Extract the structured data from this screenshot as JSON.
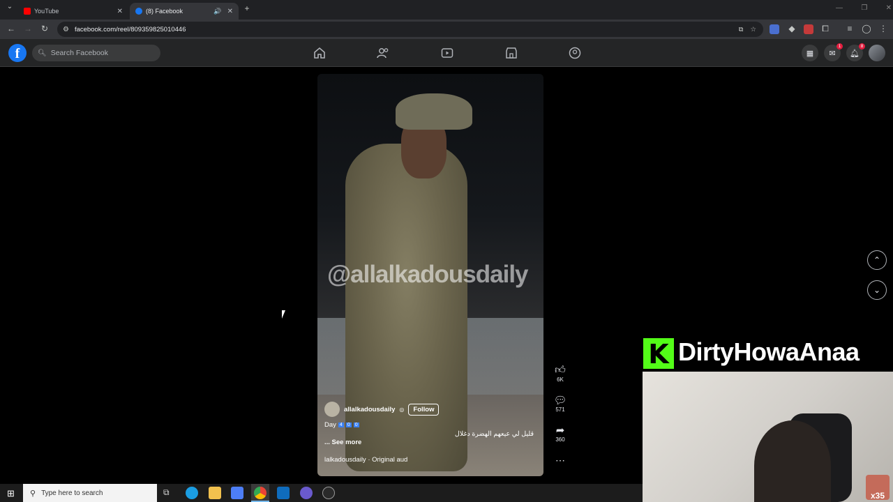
{
  "browser": {
    "tabs": [
      {
        "title": "YouTube"
      },
      {
        "title": "(8) Facebook"
      }
    ],
    "url": "facebook.com/reel/809359825010446"
  },
  "header": {
    "search_placeholder": "Search Facebook",
    "messenger_badge": "1",
    "notifications_badge": "8"
  },
  "reel": {
    "watermark": "@allalkadousdaily",
    "author": "allalkadousdaily",
    "follow_label": "Follow",
    "caption_day": "Day",
    "caption_digits": [
      "4",
      "0",
      "0"
    ],
    "caption_arabic": "قليل لي عيعهم الهضرة دغلال",
    "see_more": "... See more",
    "audio": "lalkadousdaily · Original aud",
    "likes": "6K",
    "comments": "571",
    "shares": "360"
  },
  "overlay": {
    "streamer_name": "DirtyHowaAnaa",
    "kick_logo": "K",
    "sub_badge": "x35"
  },
  "taskbar": {
    "search_placeholder": "Type here to search"
  },
  "colors": {
    "facebook_blue": "#1877f2",
    "kick_green": "#53fc18",
    "badge_red": "#e41e3f"
  }
}
